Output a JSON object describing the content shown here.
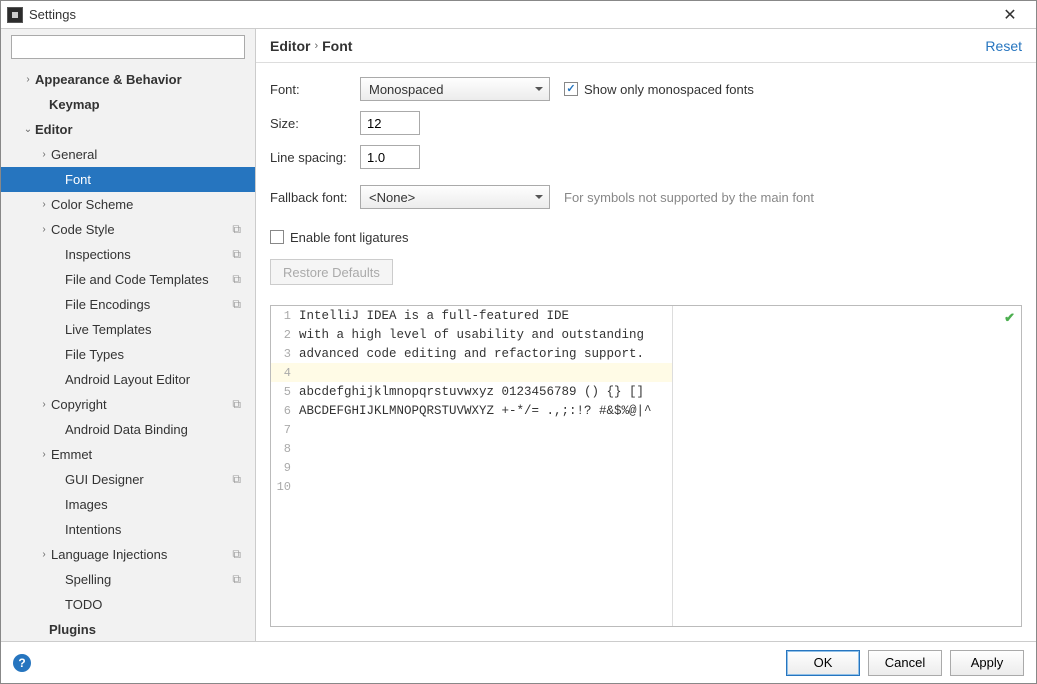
{
  "window": {
    "title": "Settings"
  },
  "search": {
    "placeholder": ""
  },
  "sidebar": {
    "items": [
      {
        "label": "Appearance & Behavior",
        "indent": 20,
        "chevron": "›",
        "bold": true
      },
      {
        "label": "Keymap",
        "indent": 34,
        "chevron": "",
        "bold": true
      },
      {
        "label": "Editor",
        "indent": 20,
        "chevron": "⌄",
        "bold": true
      },
      {
        "label": "General",
        "indent": 36,
        "chevron": "›",
        "bold": false
      },
      {
        "label": "Font",
        "indent": 50,
        "chevron": "",
        "bold": false,
        "selected": true
      },
      {
        "label": "Color Scheme",
        "indent": 36,
        "chevron": "›",
        "bold": false
      },
      {
        "label": "Code Style",
        "indent": 36,
        "chevron": "›",
        "bold": false,
        "copy": true
      },
      {
        "label": "Inspections",
        "indent": 50,
        "chevron": "",
        "bold": false,
        "copy": true
      },
      {
        "label": "File and Code Templates",
        "indent": 50,
        "chevron": "",
        "bold": false,
        "copy": true
      },
      {
        "label": "File Encodings",
        "indent": 50,
        "chevron": "",
        "bold": false,
        "copy": true
      },
      {
        "label": "Live Templates",
        "indent": 50,
        "chevron": "",
        "bold": false
      },
      {
        "label": "File Types",
        "indent": 50,
        "chevron": "",
        "bold": false
      },
      {
        "label": "Android Layout Editor",
        "indent": 50,
        "chevron": "",
        "bold": false
      },
      {
        "label": "Copyright",
        "indent": 36,
        "chevron": "›",
        "bold": false,
        "copy": true
      },
      {
        "label": "Android Data Binding",
        "indent": 50,
        "chevron": "",
        "bold": false
      },
      {
        "label": "Emmet",
        "indent": 36,
        "chevron": "›",
        "bold": false
      },
      {
        "label": "GUI Designer",
        "indent": 50,
        "chevron": "",
        "bold": false,
        "copy": true
      },
      {
        "label": "Images",
        "indent": 50,
        "chevron": "",
        "bold": false
      },
      {
        "label": "Intentions",
        "indent": 50,
        "chevron": "",
        "bold": false
      },
      {
        "label": "Language Injections",
        "indent": 36,
        "chevron": "›",
        "bold": false,
        "copy": true
      },
      {
        "label": "Spelling",
        "indent": 50,
        "chevron": "",
        "bold": false,
        "copy": true
      },
      {
        "label": "TODO",
        "indent": 50,
        "chevron": "",
        "bold": false
      },
      {
        "label": "Plugins",
        "indent": 34,
        "chevron": "",
        "bold": true
      }
    ]
  },
  "breadcrumb": {
    "part1": "Editor",
    "sep": "›",
    "part2": "Font"
  },
  "reset": "Reset",
  "form": {
    "font_label": "Font:",
    "font_value": "Monospaced",
    "mono_only": "Show only monospaced fonts",
    "size_label": "Size:",
    "size_value": "12",
    "line_spacing_label": "Line spacing:",
    "line_spacing_value": "1.0",
    "fallback_label": "Fallback font:",
    "fallback_value": "<None>",
    "fallback_hint": "For symbols not supported by the main font",
    "ligatures": "Enable font ligatures",
    "restore": "Restore Defaults"
  },
  "preview": {
    "lines": [
      "IntelliJ IDEA is a full-featured IDE",
      "with a high level of usability and outstanding",
      "advanced code editing and refactoring support.",
      "",
      "abcdefghijklmnopqrstuvwxyz 0123456789 () {} []",
      "ABCDEFGHIJKLMNOPQRSTUVWXYZ +-*/= .,;:!? #&$%@|^",
      "",
      "",
      "",
      ""
    ],
    "highlight_index": 3
  },
  "footer": {
    "ok": "OK",
    "cancel": "Cancel",
    "apply": "Apply",
    "help": "?"
  }
}
